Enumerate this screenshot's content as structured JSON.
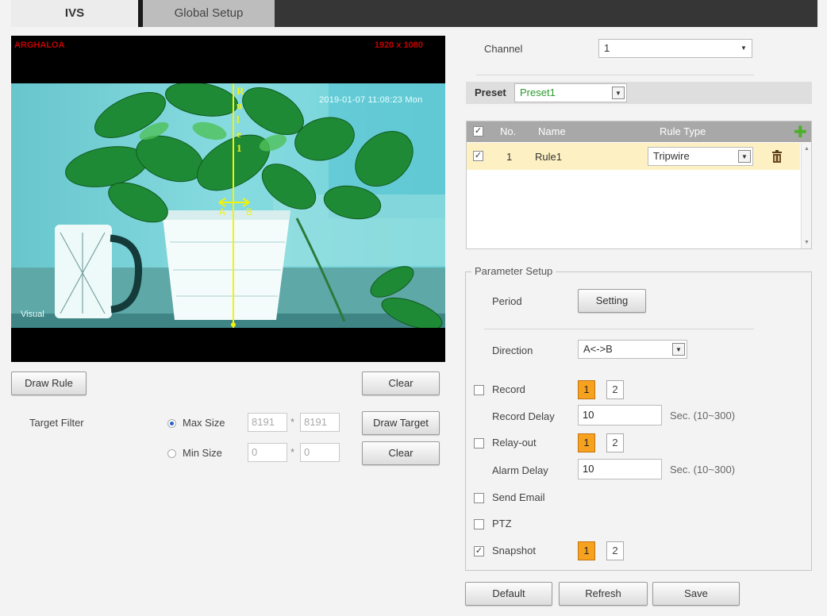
{
  "tabs": {
    "ivs": "IVS",
    "global_setup": "Global Setup"
  },
  "video": {
    "overlay_left": "ARGHALOA",
    "overlay_right": "1920 x 1080",
    "timestamp": "2019-01-07 11:08:23 Mon",
    "source_label": "Visual",
    "rule_letters": [
      "R",
      "u",
      "l",
      "e",
      "1"
    ],
    "point_a": "A",
    "point_b": "B"
  },
  "left_controls": {
    "draw_rule": "Draw Rule",
    "clear_top": "Clear",
    "target_filter": "Target Filter",
    "max_size_label": "Max Size",
    "max_w": "8191",
    "max_h": "8191",
    "min_size_label": "Min Size",
    "min_w": "0",
    "min_h": "0",
    "times": "*",
    "draw_target": "Draw Target",
    "clear_bottom": "Clear"
  },
  "channel": {
    "label": "Channel",
    "value": "1"
  },
  "preset": {
    "label": "Preset",
    "value": "Preset1"
  },
  "rule_table": {
    "headers": {
      "no": "No.",
      "name": "Name",
      "rule_type": "Rule Type"
    },
    "rows": [
      {
        "no": "1",
        "name": "Rule1",
        "rule_type": "Tripwire"
      }
    ]
  },
  "param": {
    "legend": "Parameter Setup",
    "period_label": "Period",
    "setting_btn": "Setting",
    "direction_label": "Direction",
    "direction_value": "A<->B",
    "record_label": "Record",
    "record_delay_label": "Record Delay",
    "record_delay_value": "10",
    "record_delay_hint": "Sec. (10~300)",
    "relay_label": "Relay-out",
    "alarm_delay_label": "Alarm Delay",
    "alarm_delay_value": "10",
    "alarm_delay_hint": "Sec. (10~300)",
    "send_email_label": "Send Email",
    "ptz_label": "PTZ",
    "snapshot_label": "Snapshot",
    "one": "1",
    "two": "2"
  },
  "footer": {
    "default": "Default",
    "refresh": "Refresh",
    "save": "Save"
  },
  "icons": {
    "add": "plus-icon",
    "delete": "trash-icon",
    "dropdown": "chevron-down-icon",
    "check": "✓"
  },
  "colors": {
    "accent_orange": "#f7a21f",
    "rule_line": "#f2f20a",
    "add_green": "#4caf2a",
    "tab_dark": "#363636"
  }
}
